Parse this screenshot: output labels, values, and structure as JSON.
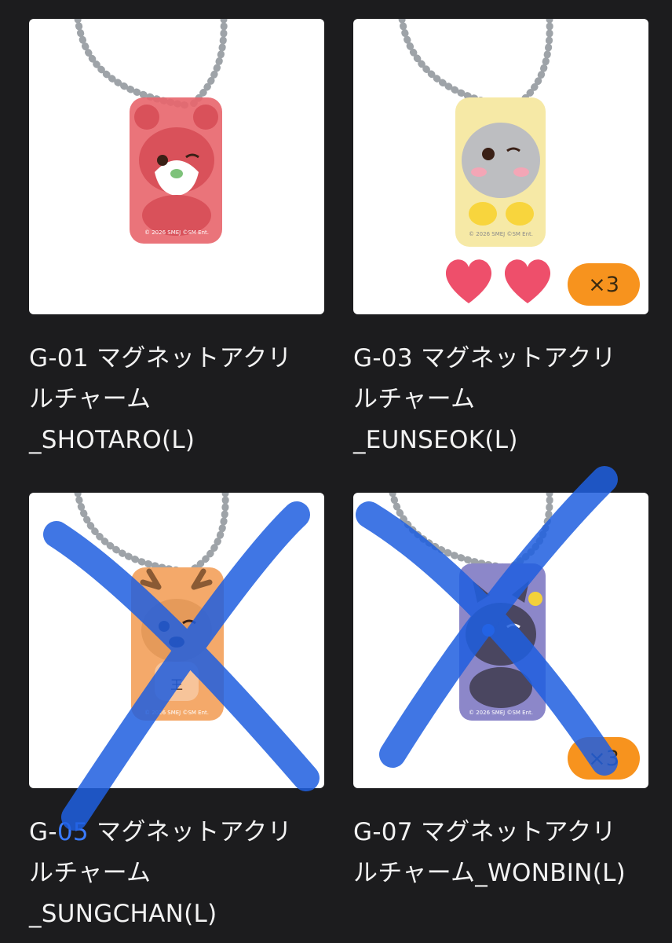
{
  "products": [
    {
      "title_line1": "G-01 マグネットアクリ",
      "title_line2": "ルチャーム",
      "title_line3": "_SHOTARO(L)",
      "copyright": "© 2026 SMEJ ©SM Ent.",
      "character": "red-bear-charm",
      "color": "#e8656b",
      "crossed_out": false
    },
    {
      "title_line1": "G-03 マグネットアクリ",
      "title_line2": "ルチャーム",
      "title_line3": "_EUNSEOK(L)",
      "copyright": "© 2026 SMEJ ©SM Ent.",
      "character": "gray-seal-charm",
      "color": "#f6e9a6",
      "badge": "×3",
      "crossed_out": false
    },
    {
      "title_prefix": "G-",
      "title_highlight": "05",
      "title_rest": " マグネットアクリ",
      "title_line2": "ルチャーム",
      "title_line3": "_SUNGCHAN(L)",
      "copyright": "© 2026 SMEJ ©SM Ent.",
      "character": "orange-deer-charm",
      "color": "#f4a96a",
      "stamp": "王",
      "crossed_out": true
    },
    {
      "title_line1": "G-07 マグネットアクリ",
      "title_line2": "ルチャーム_WONBIN(L)",
      "copyright": "© 2026 SMEJ ©SM Ent.",
      "character": "gray-cat-charm",
      "color": "#8c87c9",
      "badge": "×3",
      "crossed_out": true
    }
  ],
  "colors": {
    "background": "#1c1c1e",
    "badge": "#f7931e",
    "cross": "#1f5fe0",
    "heart": "#ee4f6b"
  }
}
